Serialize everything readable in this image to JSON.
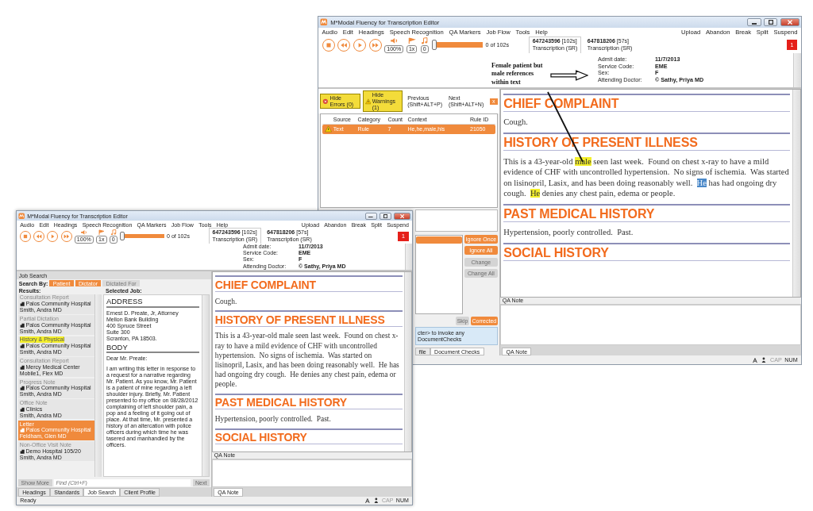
{
  "rear_window": {
    "title": "M*Modal Fluency for Transcription Editor",
    "menu": [
      "Audio",
      "Edit",
      "Headings",
      "Speech Recognition",
      "QA Markers",
      "Job Flow",
      "Tools",
      "Help"
    ],
    "actions": [
      "Upload",
      "Abandon",
      "Break",
      "Split",
      "Suspend"
    ],
    "transport": {
      "volume": "100%",
      "speed": "1x",
      "markers": "0",
      "position": {
        "level": 0
      },
      "time": "0 of 102s"
    },
    "jobs": [
      {
        "id": "647243596",
        "length": "[102s]",
        "type": "Transcription (SR)",
        "selected": true
      },
      {
        "id": "647818206",
        "length": "[57s]",
        "type": "Transcription (SR)",
        "selected": false
      }
    ],
    "alert_count": "1",
    "patient_info": [
      {
        "label": "Admit date:",
        "value": "11/7/2013"
      },
      {
        "label": "Service Code:",
        "value": "EME"
      },
      {
        "label": "Sex:",
        "value": "F"
      },
      {
        "label": "Attending Doctor:",
        "value": "© Sathy, Priya MD"
      }
    ],
    "annotation": {
      "text": "Female patient but male references within text"
    },
    "document_checks": {
      "hide_errors": "Hide Errors (0)",
      "hide_warnings": "Hide Warnings (1)",
      "previous": "Previous (Shift+ALT+P)",
      "next": "Next (Shift+ALT+N)",
      "close": "x",
      "columns": [
        "Source",
        "Category",
        "Count",
        "Context",
        "Rule ID"
      ],
      "rows": [
        {
          "kind": "warning",
          "source": "Text",
          "category": "Rule",
          "count": "7",
          "context": "He,he,male,his",
          "rule_id": "21050",
          "selected": true
        }
      ],
      "suggestions": [
        {
          "selected": true
        }
      ],
      "side_buttons": [
        {
          "label": "Ignore Once",
          "disabled": false
        },
        {
          "label": "Ignore All",
          "disabled": false
        },
        {
          "label": "Change",
          "disabled": true
        },
        {
          "label": "Change All",
          "disabled": true
        }
      ],
      "bottom_buttons": [
        {
          "label": "Skip",
          "disabled": true
        },
        {
          "label": "Corrected",
          "disabled": false
        }
      ],
      "hint": "cter> to invoke any DocumentChecks",
      "tabs": [
        {
          "label": "file",
          "selected": false
        },
        {
          "label": "Document Checks",
          "selected": true
        }
      ]
    },
    "editor": {
      "sections": [
        {
          "heading": "CHIEF COMPLAINT",
          "body": [
            {
              "text": "Cough.",
              "highlighted": false,
              "selected": false
            }
          ]
        },
        {
          "heading": "HISTORY OF PRESENT ILLNESS",
          "body": [
            {
              "text": "This is a 43-year-old ",
              "highlighted": false,
              "selected": false
            },
            {
              "text": "male",
              "highlighted": true,
              "selected": false
            },
            {
              "text": " seen last week.  Found on chest x-ray to have a mild evidence of CHF with uncontrolled hypertension.  No signs of ischemia.  Was started on lisinopril, Lasix, and has been doing reasonably well.  ",
              "highlighted": false,
              "selected": false
            },
            {
              "text": "He",
              "highlighted": false,
              "selected": true
            },
            {
              "text": " has had ongoing dry cough.  ",
              "highlighted": false,
              "selected": false
            },
            {
              "text": "He",
              "highlighted": true,
              "selected": false
            },
            {
              "text": " denies any chest pain, edema or people.",
              "highlighted": false,
              "selected": false
            }
          ]
        },
        {
          "heading": "PAST MEDICAL HISTORY",
          "body": [
            {
              "text": "Hypertension, poorly controlled.  Past.",
              "highlighted": false,
              "selected": false
            }
          ]
        },
        {
          "heading": "SOCIAL HISTORY"
        }
      ]
    },
    "qa_note": {
      "label": "QA Note",
      "tab": "QA Note"
    },
    "status": {
      "indicators": [
        {
          "label": "CAP",
          "on": false
        },
        {
          "label": "NUM",
          "on": true
        }
      ]
    }
  },
  "front_window": {
    "title": "M*Modal Fluency for Transcription Editor",
    "menu": [
      "Audio",
      "Edit",
      "Headings",
      "Speech Recognition",
      "QA Markers",
      "Job Flow",
      "Tools",
      "Help"
    ],
    "actions": [
      "Upload",
      "Abandon",
      "Break",
      "Split",
      "Suspend"
    ],
    "transport": {
      "volume": "100%",
      "speed": "1x",
      "markers": "0",
      "position": {
        "level": 0
      },
      "time": "0 of 102s"
    },
    "jobs": [
      {
        "id": "647243596",
        "length": "[102s]",
        "type": "Transcription (SR)",
        "selected": true
      },
      {
        "id": "647818206",
        "length": "[57s]",
        "type": "Transcription (SR)",
        "selected": false
      }
    ],
    "alert_count": "1",
    "patient_info": [
      {
        "label": "Admit date:",
        "value": "11/7/2013"
      },
      {
        "label": "Service Code:",
        "value": "EME"
      },
      {
        "label": "Sex:",
        "value": "F"
      },
      {
        "label": "Attending Doctor:",
        "value": "© Sathy, Priya MD"
      }
    ],
    "job_search": {
      "title": "Job Search",
      "search_by": "Search By:",
      "filters": [
        {
          "label": "Patient",
          "enabled": true
        },
        {
          "label": "Dictator",
          "enabled": true
        },
        {
          "label": "Dictated For",
          "enabled": false
        }
      ],
      "results_label": "Results:",
      "selected_label": "Selected Job:",
      "results": [
        {
          "title": "Consultation Report",
          "location": "Palos Community Hospital",
          "author": "Smith, Andra MD",
          "selected": false,
          "highlighted": false
        },
        {
          "title": "Partial Dictation",
          "location": "Palos Community Hospital",
          "author": "Smith, Andra MD",
          "selected": false,
          "highlighted": false
        },
        {
          "title": "History & Physical",
          "location": "Palos Community Hospital",
          "author": "Smith, Andra MD",
          "selected": false,
          "highlighted": true
        },
        {
          "title": "Consultation Report",
          "location": "Mercy Medical Center",
          "author": "Mobile1, Flex MD",
          "selected": false,
          "highlighted": false
        },
        {
          "title": "Progress Note",
          "location": "Palos Community Hospital",
          "author": "Smith, Andra MD",
          "selected": false,
          "highlighted": false
        },
        {
          "title": "Office Note",
          "location": "Clinics",
          "author": "Smith, Andra MD",
          "selected": false,
          "highlighted": false
        },
        {
          "title": "Letter",
          "location": "Palos Community Hospital",
          "author": "Feldham, Glen MD",
          "selected": true,
          "highlighted": false
        },
        {
          "title": "Non-Office Visit Note",
          "location": "Demo Hospital 105/20",
          "author": "Smith, Andra MD",
          "selected": false,
          "highlighted": false
        }
      ],
      "preview": {
        "address_heading": "ADDRESS",
        "address": [
          "Ernest D. Preate, Jr, Attorney",
          "Mellon Bank Building",
          "400 Spruce Street",
          "Suite 300",
          "Scranton, PA 18503."
        ],
        "body_heading": "BODY",
        "salutation": "Dear Mr. Preate:",
        "paragraph": "I am writing this letter in response to a request for a narrative regarding Mr. Patient. As you know, Mr. Patient is a patient of mine regarding a left shoulder injury. Briefly, Mr. Patient presented to my office on 08/28/2012 complaining of left shoulder pain, a pop and a feeling of it going out of place. At that time, Mr. presented a history of an altercation with police officers during which time he was tasered and manhandled by the officers."
      },
      "show_more": "Show More",
      "find_placeholder": "Find (Ctrl+F)",
      "next": "Next",
      "tabs": [
        {
          "label": "Headings",
          "selected": false
        },
        {
          "label": "Standards",
          "selected": false
        },
        {
          "label": "Job Search",
          "selected": true
        },
        {
          "label": "Client Profile",
          "selected": false
        }
      ]
    },
    "editor": {
      "sections": [
        {
          "heading": "CHIEF COMPLAINT",
          "body": [
            {
              "text": "Cough.",
              "highlighted": false,
              "selected": false
            }
          ]
        },
        {
          "heading": "HISTORY OF PRESENT ILLNESS",
          "body": [
            {
              "text": "This is a 43-year-old male seen last week.  Found on chest x-ray to have a mild evidence of CHF with uncontrolled hypertension.  No signs of ischemia.  Was started on lisinopril, Lasix, and has been doing reasonably well.  He has had ongoing dry cough.  He denies any chest pain, edema or people.",
              "highlighted": false,
              "selected": false
            }
          ]
        },
        {
          "heading": "PAST MEDICAL HISTORY",
          "body": [
            {
              "text": "Hypertension, poorly controlled.  Past.",
              "highlighted": false,
              "selected": false
            }
          ]
        },
        {
          "heading": "SOCIAL HISTORY"
        }
      ]
    },
    "qa_note": {
      "label": "QA Note",
      "tab": "QA Note"
    },
    "status": {
      "text": "Ready",
      "indicators": [
        {
          "label": "CAP",
          "on": false
        },
        {
          "label": "NUM",
          "on": true
        }
      ]
    }
  }
}
